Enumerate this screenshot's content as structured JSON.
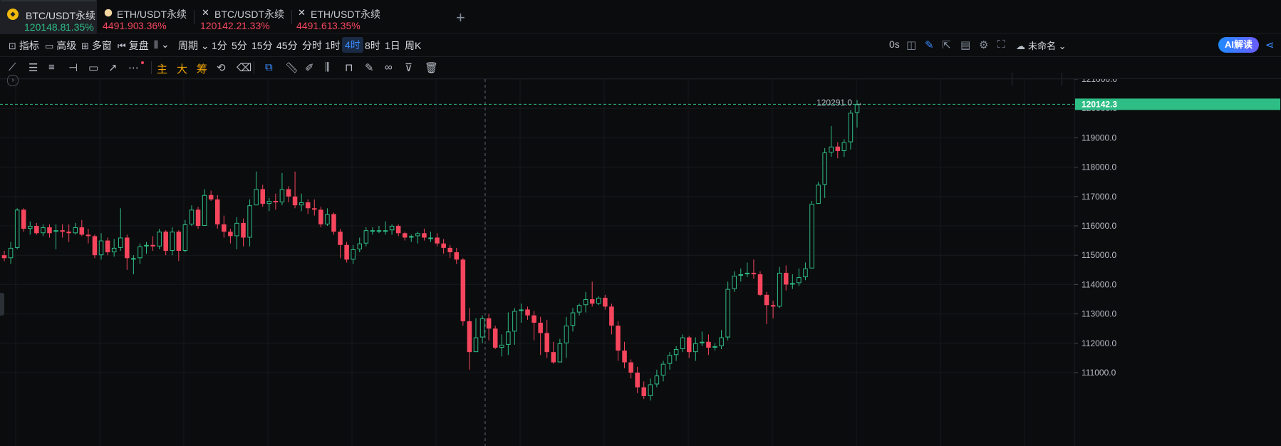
{
  "tabs": [
    {
      "name": "BTC/USDT永续",
      "price": "120148.8",
      "pct": "1.35%",
      "trend": "up",
      "active": true,
      "icon": "binance-logo-icon"
    },
    {
      "name": "ETH/USDT永续",
      "price": "4491.90",
      "pct": "3.36%",
      "trend": "down",
      "active": false,
      "icon": "coin-icon"
    },
    {
      "name": "BTC/USDT永续",
      "price": "120142.2",
      "pct": "1.33%",
      "trend": "down",
      "active": false,
      "icon": "x-icon"
    },
    {
      "name": "ETH/USDT永续",
      "price": "4491.61",
      "pct": "3.35%",
      "trend": "down",
      "active": false,
      "icon": "x-icon"
    }
  ],
  "add_tab": "+",
  "toolbar": {
    "indicator": "指标",
    "advanced": "高级",
    "multi_window": "多窗",
    "replay": "复盘",
    "period": "周期",
    "intervals": [
      "1分",
      "5分",
      "15分",
      "45分",
      "分时",
      "1时",
      "4时",
      "8时",
      "1日",
      "周K"
    ],
    "active_interval": "4时",
    "countdown": "0s",
    "layout_name": "未命名",
    "ai_button": "AI解读"
  },
  "drawing_tools": {
    "main": "主",
    "big": "大",
    "chip": "筹"
  },
  "colors": {
    "up": "#2ebd85",
    "down": "#f6465d",
    "background": "#0b0c0e",
    "accent": "#3b8cff",
    "price_line": "#2ebd85"
  },
  "chart_data": {
    "type": "candlestick",
    "interval": "4时",
    "y_ticks": [
      121000.0,
      120000.0,
      119000.0,
      118000.0,
      117000.0,
      116000.0,
      115000.0,
      114000.0,
      113000.0,
      112000.0,
      111000.0
    ],
    "ylim": [
      110900,
      121300
    ],
    "last_price": "120142.3",
    "high_marker": "120291.0 →",
    "candles": [
      [
        115000,
        114900,
        115150,
        114800
      ],
      [
        114900,
        115250,
        115450,
        114700
      ],
      [
        115250,
        116550,
        116600,
        115200
      ],
      [
        116550,
        115900,
        116600,
        115800
      ],
      [
        115900,
        116000,
        116150,
        115700
      ],
      [
        116000,
        115750,
        116100,
        115700
      ],
      [
        115750,
        115950,
        116050,
        115650
      ],
      [
        115950,
        115750,
        116050,
        115600
      ],
      [
        115800,
        115850,
        116050,
        115200
      ],
      [
        115850,
        115800,
        116050,
        115600
      ],
      [
        115800,
        115750,
        116050,
        115450
      ],
      [
        115750,
        115950,
        116100,
        115700
      ],
      [
        115950,
        115700,
        116200,
        115650
      ],
      [
        115700,
        115650,
        115900,
        115400
      ],
      [
        115650,
        115000,
        115700,
        114900
      ],
      [
        115000,
        115500,
        115750,
        114850
      ],
      [
        115500,
        115100,
        115600,
        115000
      ],
      [
        115100,
        115250,
        115550,
        114950
      ],
      [
        115250,
        115600,
        116600,
        115150
      ],
      [
        115600,
        114900,
        115700,
        114500
      ],
      [
        114900,
        114900,
        115000,
        114350
      ],
      [
        114900,
        115300,
        115400,
        114700
      ],
      [
        115300,
        115350,
        115450,
        115050
      ],
      [
        115350,
        115300,
        115650,
        115150
      ],
      [
        115300,
        115800,
        115900,
        115200
      ],
      [
        115800,
        115150,
        115850,
        115000
      ],
      [
        115150,
        115800,
        115950,
        115000
      ],
      [
        115800,
        115150,
        115850,
        114800
      ],
      [
        115150,
        116050,
        116200,
        115100
      ],
      [
        116050,
        116550,
        116700,
        116000
      ],
      [
        116550,
        116000,
        116650,
        115900
      ],
      [
        116000,
        117050,
        117250,
        116000
      ],
      [
        117050,
        116900,
        117200,
        116850
      ],
      [
        116900,
        116050,
        117050,
        115900
      ],
      [
        116050,
        115800,
        116350,
        115600
      ],
      [
        115800,
        115650,
        115900,
        115400
      ],
      [
        115650,
        116100,
        116300,
        115200
      ],
      [
        116100,
        115600,
        116250,
        115300
      ],
      [
        115600,
        116700,
        116900,
        115300
      ],
      [
        116700,
        117250,
        117850,
        116700
      ],
      [
        117250,
        116750,
        117400,
        116650
      ],
      [
        116750,
        116850,
        116950,
        116500
      ],
      [
        116850,
        116800,
        117100,
        116550
      ],
      [
        116800,
        117250,
        117800,
        116700
      ],
      [
        117250,
        117000,
        117350,
        116800
      ],
      [
        117000,
        116700,
        117850,
        116600
      ],
      [
        116700,
        116800,
        117100,
        116500
      ],
      [
        116800,
        116600,
        116900,
        116400
      ],
      [
        116600,
        116550,
        116900,
        116350
      ],
      [
        116550,
        116050,
        116650,
        115950
      ],
      [
        116050,
        116400,
        116600,
        116000
      ],
      [
        116400,
        115800,
        116450,
        115700
      ],
      [
        115800,
        115350,
        115900,
        114900
      ],
      [
        115350,
        114850,
        115450,
        114750
      ],
      [
        114850,
        115200,
        115350,
        114700
      ],
      [
        115200,
        115400,
        115600,
        115100
      ],
      [
        115400,
        115850,
        115950,
        115300
      ],
      [
        115850,
        115850,
        115950,
        115700
      ],
      [
        115850,
        115850,
        116000,
        115750
      ],
      [
        115850,
        115850,
        116150,
        115700
      ],
      [
        115850,
        116000,
        116050,
        115700
      ],
      [
        116000,
        115750,
        116050,
        115650
      ],
      [
        115750,
        115600,
        115800,
        115500
      ],
      [
        115600,
        115650,
        115700,
        115450
      ],
      [
        115650,
        115750,
        115800,
        115400
      ],
      [
        115750,
        115600,
        115900,
        115500
      ],
      [
        115600,
        115600,
        115800,
        115450
      ],
      [
        115600,
        115400,
        115750,
        115300
      ],
      [
        115400,
        115250,
        115550,
        115050
      ],
      [
        115250,
        115100,
        115350,
        114900
      ],
      [
        115100,
        114850,
        115250,
        114700
      ],
      [
        114850,
        112750,
        114900,
        112600
      ],
      [
        112750,
        111700,
        113200,
        111100
      ],
      [
        111700,
        112200,
        112850,
        111850
      ],
      [
        112200,
        112850,
        112950,
        112000
      ],
      [
        112850,
        112500,
        113000,
        112100
      ],
      [
        112500,
        111850,
        112600,
        111800
      ],
      [
        111850,
        111950,
        112300,
        111550
      ],
      [
        111950,
        112400,
        113050,
        111600
      ],
      [
        112400,
        113100,
        113200,
        111950
      ],
      [
        113100,
        113150,
        113350,
        112700
      ],
      [
        113150,
        112950,
        113250,
        112800
      ],
      [
        112950,
        112700,
        113100,
        112100
      ],
      [
        112700,
        112350,
        112900,
        111600
      ],
      [
        112350,
        111700,
        112800,
        111500
      ],
      [
        111700,
        111350,
        112050,
        111300
      ],
      [
        111350,
        112000,
        112150,
        111650
      ],
      [
        112000,
        112600,
        112900,
        111500
      ],
      [
        112600,
        113050,
        113200,
        112400
      ],
      [
        113050,
        113300,
        113350,
        112950
      ],
      [
        113300,
        113500,
        113750,
        113050
      ],
      [
        113500,
        113350,
        114100,
        113250
      ],
      [
        113350,
        113550,
        113600,
        113300
      ],
      [
        113550,
        113250,
        113650,
        113150
      ],
      [
        113250,
        112600,
        113350,
        112300
      ],
      [
        112600,
        111750,
        112750,
        111400
      ],
      [
        111750,
        111350,
        112050,
        111150
      ],
      [
        111350,
        111000,
        111450,
        110800
      ],
      [
        111000,
        110500,
        111200,
        110300
      ],
      [
        110500,
        110200,
        110700,
        110100
      ],
      [
        110200,
        110600,
        110800,
        110050
      ],
      [
        110600,
        110900,
        111100,
        110500
      ],
      [
        110900,
        111300,
        111400,
        110700
      ],
      [
        111300,
        111600,
        111700,
        111100
      ],
      [
        111600,
        111800,
        111900,
        111400
      ],
      [
        111800,
        112200,
        112300,
        111700
      ],
      [
        112200,
        111700,
        112250,
        111500
      ],
      [
        111700,
        112000,
        112200,
        111400
      ],
      [
        112000,
        112050,
        112400,
        111900
      ],
      [
        112050,
        111850,
        112300,
        111600
      ],
      [
        111850,
        111900,
        112000,
        111750
      ],
      [
        111900,
        112200,
        112450,
        111800
      ],
      [
        112200,
        113850,
        114100,
        112100
      ],
      [
        113850,
        114300,
        114450,
        113750
      ],
      [
        114300,
        114350,
        114550,
        114100
      ],
      [
        114350,
        114400,
        114750,
        114250
      ],
      [
        114400,
        114350,
        114850,
        114200
      ],
      [
        114350,
        113650,
        114450,
        113600
      ],
      [
        113650,
        113300,
        113750,
        112650
      ],
      [
        113300,
        113250,
        113450,
        112850
      ],
      [
        113250,
        114400,
        114600,
        113200
      ],
      [
        114400,
        114000,
        114650,
        113800
      ],
      [
        114000,
        114050,
        114350,
        113850
      ],
      [
        114050,
        114250,
        114550,
        113950
      ],
      [
        114250,
        114550,
        114750,
        114150
      ],
      [
        114550,
        116750,
        116850,
        114550
      ],
      [
        116750,
        117400,
        117500,
        116900
      ],
      [
        117400,
        118500,
        118650,
        116950
      ],
      [
        118500,
        118700,
        119400,
        118350
      ],
      [
        118700,
        118550,
        118850,
        118300
      ],
      [
        118550,
        118850,
        118950,
        118350
      ],
      [
        118850,
        119850,
        119950,
        118600
      ],
      [
        119850,
        120142,
        120291,
        119350
      ]
    ]
  }
}
